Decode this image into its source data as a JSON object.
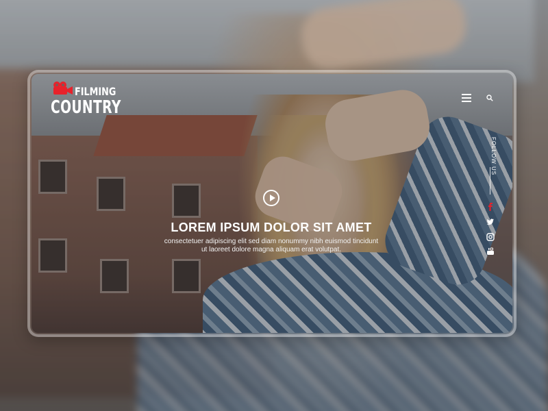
{
  "brand": {
    "line1": "FILMING",
    "line2": "COUNTRY",
    "accent_color": "#e8222b"
  },
  "nav": {
    "menu_icon": "hamburger-menu-icon",
    "search_icon": "search-icon"
  },
  "hero": {
    "headline": "LOREM IPSUM DOLOR SIT AMET",
    "subtext_line1": "consectetuer adipiscing elit sed diam nonummy nibh euismod tincidunt",
    "subtext_line2": "ut laoreet dolore magna aliquam erat volutpat.",
    "play_icon": "play-icon"
  },
  "social": {
    "label": "FOLLOW US",
    "items": [
      {
        "icon": "facebook-icon",
        "color": "#e8222b"
      },
      {
        "icon": "twitter-icon",
        "color": "#ffffff"
      },
      {
        "icon": "instagram-icon",
        "color": "#ffffff"
      },
      {
        "icon": "youtube-icon",
        "color": "#ffffff"
      }
    ]
  }
}
